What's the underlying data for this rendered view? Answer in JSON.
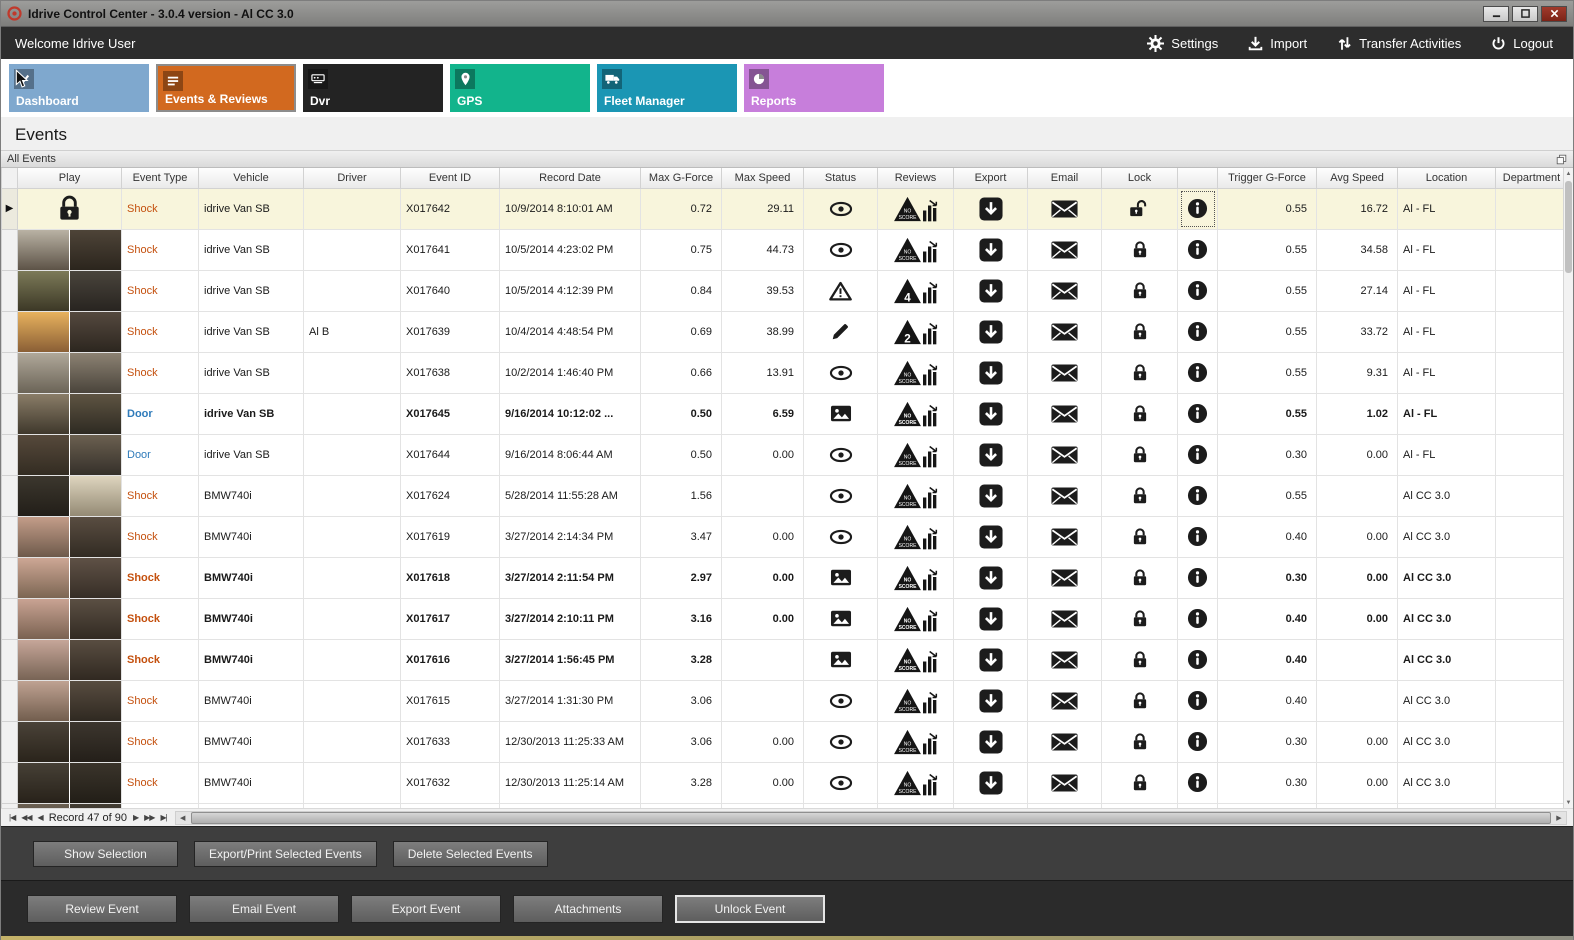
{
  "window": {
    "title": "Idrive Control Center - 3.0.4 version - Al CC 3.0"
  },
  "topbar": {
    "welcome": "Welcome Idrive User",
    "actions": [
      {
        "label": "Settings",
        "icon": "gear"
      },
      {
        "label": "Import",
        "icon": "import"
      },
      {
        "label": "Transfer Activities",
        "icon": "transfer"
      },
      {
        "label": "Logout",
        "icon": "power"
      }
    ]
  },
  "nav_tiles": [
    {
      "label": "Dashboard",
      "icon": "check",
      "color": "#7fa8ce",
      "active": false
    },
    {
      "label": "Events & Reviews",
      "icon": "list",
      "color": "#d2691f",
      "active": true
    },
    {
      "label": "Dvr",
      "icon": "dvr",
      "color": "#232323",
      "active": false
    },
    {
      "label": "GPS",
      "icon": "pin",
      "color": "#12b48c",
      "active": false
    },
    {
      "label": "Fleet Manager",
      "icon": "fleet",
      "color": "#1b96b4",
      "active": false
    },
    {
      "label": "Reports",
      "icon": "pie",
      "color": "#c77edb",
      "active": false
    }
  ],
  "page": {
    "title": "Events",
    "group_label": "All Events"
  },
  "table": {
    "columns": [
      "Play",
      "Event Type",
      "Vehicle",
      "Driver",
      "Event ID",
      "Record Date",
      "Max G-Force",
      "Max Speed",
      "Status",
      "Reviews",
      "Export",
      "Email",
      "Lock",
      "",
      "Trigger G-Force",
      "Avg Speed",
      "Location",
      "Department"
    ],
    "action_icons": {
      "status_viewed": "eye-icon",
      "status_alert": "warning-icon",
      "status_edited": "pencil-icon",
      "status_snapshot": "picture-icon",
      "review_badge": "score-triangle-icon",
      "review_chart": "bar-chart-icon",
      "export": "export-icon",
      "email": "envelope-icon",
      "lock": "lock-icon",
      "unlock": "unlock-icon",
      "info": "info-icon",
      "play_locked": "lock-icon"
    },
    "rows": [
      {
        "selected": true,
        "bold": false,
        "play": "locked",
        "event_type": "Shock",
        "vehicle": "idrive Van SB",
        "driver": "",
        "event_id": "X017642",
        "record_date": "10/9/2014 8:10:01 AM",
        "max_g": "0.72",
        "max_speed": "29.11",
        "status": "eye",
        "review": "NO SCORE",
        "locked": false,
        "trigger_g": "0.55",
        "avg_speed": "16.72",
        "location": "Al - FL",
        "department": ""
      },
      {
        "selected": false,
        "bold": false,
        "event_type": "Shock",
        "vehicle": "idrive Van SB",
        "driver": "",
        "event_id": "X017641",
        "record_date": "10/5/2014 4:23:02 PM",
        "max_g": "0.75",
        "max_speed": "44.73",
        "status": "eye",
        "review": "NO SCORE",
        "locked": true,
        "trigger_g": "0.55",
        "avg_speed": "34.58",
        "location": "Al - FL",
        "department": "",
        "thumb": {
          "l": [
            "#b9b2a4",
            "#5d5347"
          ],
          "r": [
            "#4e4438",
            "#2b251d"
          ]
        }
      },
      {
        "selected": false,
        "bold": false,
        "event_type": "Shock",
        "vehicle": "idrive Van SB",
        "driver": "",
        "event_id": "X017640",
        "record_date": "10/5/2014 4:12:39 PM",
        "max_g": "0.84",
        "max_speed": "39.53",
        "status": "warning",
        "review": "4",
        "locked": true,
        "trigger_g": "0.55",
        "avg_speed": "27.14",
        "location": "Al - FL",
        "department": "",
        "thumb": {
          "l": [
            "#7c7a58",
            "#3c3826"
          ],
          "r": [
            "#49443c",
            "#282420"
          ]
        }
      },
      {
        "selected": false,
        "bold": false,
        "event_type": "Shock",
        "vehicle": "idrive Van SB",
        "driver": "Al B",
        "event_id": "X017639",
        "record_date": "10/4/2014 4:48:54 PM",
        "max_g": "0.69",
        "max_speed": "38.99",
        "status": "pencil",
        "review": "2",
        "locked": true,
        "trigger_g": "0.55",
        "avg_speed": "33.72",
        "location": "Al - FL",
        "department": "",
        "thumb": {
          "l": [
            "#e8b25e",
            "#8a5f36"
          ],
          "r": [
            "#55493f",
            "#2c261f"
          ]
        }
      },
      {
        "selected": false,
        "bold": false,
        "event_type": "Shock",
        "vehicle": "idrive Van SB",
        "driver": "",
        "event_id": "X017638",
        "record_date": "10/2/2014 1:46:40 PM",
        "max_g": "0.66",
        "max_speed": "13.91",
        "status": "eye",
        "review": "NO SCORE",
        "locked": true,
        "trigger_g": "0.55",
        "avg_speed": "9.31",
        "location": "Al - FL",
        "department": "",
        "thumb": {
          "l": [
            "#b0a89a",
            "#6b6457"
          ],
          "r": [
            "#8c8273",
            "#4a443b"
          ]
        }
      },
      {
        "selected": false,
        "bold": true,
        "event_type": "Door",
        "vehicle": "idrive Van SB",
        "driver": "",
        "event_id": "X017645",
        "record_date": "9/16/2014 10:12:02 ...",
        "max_g": "0.50",
        "max_speed": "6.59",
        "status": "picture",
        "review": "NO SCORE",
        "locked": true,
        "trigger_g": "0.55",
        "avg_speed": "1.02",
        "location": "Al - FL",
        "department": "",
        "thumb": {
          "l": [
            "#8a7d68",
            "#3f382c"
          ],
          "r": [
            "#5e5442",
            "#2e2a22"
          ]
        }
      },
      {
        "selected": false,
        "bold": false,
        "event_type": "Door",
        "vehicle": "idrive Van SB",
        "driver": "",
        "event_id": "X017644",
        "record_date": "9/16/2014 8:06:44 AM",
        "max_g": "0.50",
        "max_speed": "0.00",
        "status": "eye",
        "review": "NO SCORE",
        "locked": true,
        "trigger_g": "0.30",
        "avg_speed": "0.00",
        "location": "Al - FL",
        "department": "",
        "thumb": {
          "l": [
            "#56493b",
            "#332c22"
          ],
          "r": [
            "#6b6050",
            "#35302a"
          ]
        }
      },
      {
        "selected": false,
        "bold": false,
        "event_type": "Shock",
        "vehicle": "BMW740i",
        "driver": "",
        "event_id": "X017624",
        "record_date": "5/28/2014 11:55:28 AM",
        "max_g": "1.56",
        "max_speed": "",
        "status": "eye",
        "review": "NO SCORE",
        "locked": true,
        "trigger_g": "0.55",
        "avg_speed": "",
        "location": "Al CC 3.0",
        "department": "",
        "thumb": {
          "l": [
            "#3c372e",
            "#221e18"
          ],
          "r": [
            "#ded5bf",
            "#948a74"
          ]
        }
      },
      {
        "selected": false,
        "bold": false,
        "event_type": "Shock",
        "vehicle": "BMW740i",
        "driver": "",
        "event_id": "X017619",
        "record_date": "3/27/2014 2:14:34 PM",
        "max_g": "3.47",
        "max_speed": "0.00",
        "status": "eye",
        "review": "NO SCORE",
        "locked": true,
        "trigger_g": "0.40",
        "avg_speed": "0.00",
        "location": "Al CC 3.0",
        "department": "",
        "thumb": {
          "l": [
            "#c39d89",
            "#6e5a4b"
          ],
          "r": [
            "#594d41",
            "#322b23"
          ]
        }
      },
      {
        "selected": false,
        "bold": true,
        "event_type": "Shock",
        "vehicle": "BMW740i",
        "driver": "",
        "event_id": "X017618",
        "record_date": "3/27/2014 2:11:54 PM",
        "max_g": "2.97",
        "max_speed": "0.00",
        "status": "picture",
        "review": "NO SCORE",
        "locked": true,
        "trigger_g": "0.30",
        "avg_speed": "0.00",
        "location": "Al CC 3.0",
        "department": "",
        "thumb": {
          "l": [
            "#cda795",
            "#7c6653"
          ],
          "r": [
            "#5f5146",
            "#362e26"
          ]
        }
      },
      {
        "selected": false,
        "bold": true,
        "event_type": "Shock",
        "vehicle": "BMW740i",
        "driver": "",
        "event_id": "X017617",
        "record_date": "3/27/2014 2:10:11 PM",
        "max_g": "3.16",
        "max_speed": "0.00",
        "status": "picture",
        "review": "NO SCORE",
        "locked": true,
        "trigger_g": "0.40",
        "avg_speed": "0.00",
        "location": "Al CC 3.0",
        "department": "",
        "thumb": {
          "l": [
            "#c9a393",
            "#7a6251"
          ],
          "r": [
            "#5b4f43",
            "#332b23"
          ]
        }
      },
      {
        "selected": false,
        "bold": true,
        "event_type": "Shock",
        "vehicle": "BMW740i",
        "driver": "",
        "event_id": "X017616",
        "record_date": "3/27/2014 1:56:45 PM",
        "max_g": "3.28",
        "max_speed": "",
        "status": "picture",
        "review": "NO SCORE",
        "locked": true,
        "trigger_g": "0.40",
        "avg_speed": "",
        "location": "Al CC 3.0",
        "department": "",
        "thumb": {
          "l": [
            "#c6a699",
            "#786455"
          ],
          "r": [
            "#594d41",
            "#312921"
          ]
        }
      },
      {
        "selected": false,
        "bold": false,
        "event_type": "Shock",
        "vehicle": "BMW740i",
        "driver": "",
        "event_id": "X017615",
        "record_date": "3/27/2014 1:31:30 PM",
        "max_g": "3.06",
        "max_speed": "",
        "status": "eye",
        "review": "NO SCORE",
        "locked": true,
        "trigger_g": "0.40",
        "avg_speed": "",
        "location": "Al CC 3.0",
        "department": "",
        "thumb": {
          "l": [
            "#bfa292",
            "#725e4e"
          ],
          "r": [
            "#584c40",
            "#2f2921"
          ]
        }
      },
      {
        "selected": false,
        "bold": false,
        "event_type": "Shock",
        "vehicle": "BMW740i",
        "driver": "",
        "event_id": "X017633",
        "record_date": "12/30/2013 11:25:33 AM",
        "max_g": "3.06",
        "max_speed": "0.00",
        "status": "eye",
        "review": "NO SCORE",
        "locked": true,
        "trigger_g": "0.30",
        "avg_speed": "0.00",
        "location": "Al CC 3.0",
        "department": "",
        "thumb": {
          "l": [
            "#4a4238",
            "#2a241b"
          ],
          "r": [
            "#3c362e",
            "#241f19"
          ]
        }
      },
      {
        "selected": false,
        "bold": false,
        "event_type": "Shock",
        "vehicle": "BMW740i",
        "driver": "",
        "event_id": "X017632",
        "record_date": "12/30/2013 11:25:14 AM",
        "max_g": "3.28",
        "max_speed": "0.00",
        "status": "eye",
        "review": "NO SCORE",
        "locked": true,
        "trigger_g": "0.30",
        "avg_speed": "0.00",
        "location": "Al CC 3.0",
        "department": "",
        "thumb": {
          "l": [
            "#464036",
            "#28221a"
          ],
          "r": [
            "#3a342b",
            "#221e17"
          ]
        }
      },
      {
        "selected": false,
        "bold": false,
        "partial": true,
        "event_type": "",
        "vehicle": "",
        "driver": "",
        "event_id": "",
        "record_date": "",
        "max_g": "",
        "max_speed": "",
        "status": "",
        "review": "",
        "locked": true,
        "trigger_g": "",
        "avg_speed": "",
        "location": "",
        "department": "",
        "thumb": {
          "l": [
            "#6b6052",
            "#3a342c"
          ],
          "r": [
            "#443e34",
            "#262119"
          ]
        }
      }
    ]
  },
  "footer": {
    "record_status": "Record 47 of 90",
    "record_nav_icons": [
      "first-record-icon",
      "prev-page-icon",
      "prev-record-icon",
      "next-record-icon",
      "next-page-icon",
      "last-record-icon"
    ],
    "selection_buttons": [
      "Show Selection",
      "Export/Print Selected Events",
      "Delete Selected  Events"
    ],
    "event_buttons": [
      "Review Event",
      "Email Event",
      "Export Event",
      "Attachments",
      "Unlock Event"
    ],
    "focused_event_button": "Unlock Event"
  }
}
